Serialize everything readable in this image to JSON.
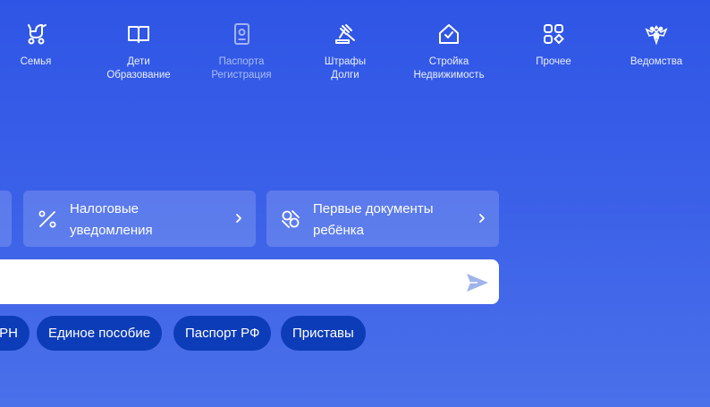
{
  "nav": {
    "items": [
      {
        "label": "Семья",
        "icon": "stroller-icon"
      },
      {
        "label": "Дети\nОбразование",
        "icon": "book-icon"
      },
      {
        "label": "Паспорта\nРегистрация",
        "icon": "passport-icon"
      },
      {
        "label": "Штрафы\nДолги",
        "icon": "gavel-icon"
      },
      {
        "label": "Стройка\nНедвижимость",
        "icon": "house-icon"
      },
      {
        "label": "Прочее",
        "icon": "grid-icon"
      },
      {
        "label": "Ведомства",
        "icon": "emblem-icon"
      }
    ]
  },
  "cards": [
    {
      "label": "Налоговые\nуведомления",
      "icon": "percent-icon"
    },
    {
      "label": "Первые документы\nребёнка",
      "icon": "pacifier-icon"
    }
  ],
  "search": {
    "placeholder": "",
    "value": ""
  },
  "chips": [
    {
      "label": "РН"
    },
    {
      "label": "Единое пособие"
    },
    {
      "label": "Паспорт РФ"
    },
    {
      "label": "Приставы"
    }
  ],
  "colors": {
    "accent": "#2f55e6",
    "chip": "#0d3cb8",
    "send": "#9fb4ea"
  }
}
